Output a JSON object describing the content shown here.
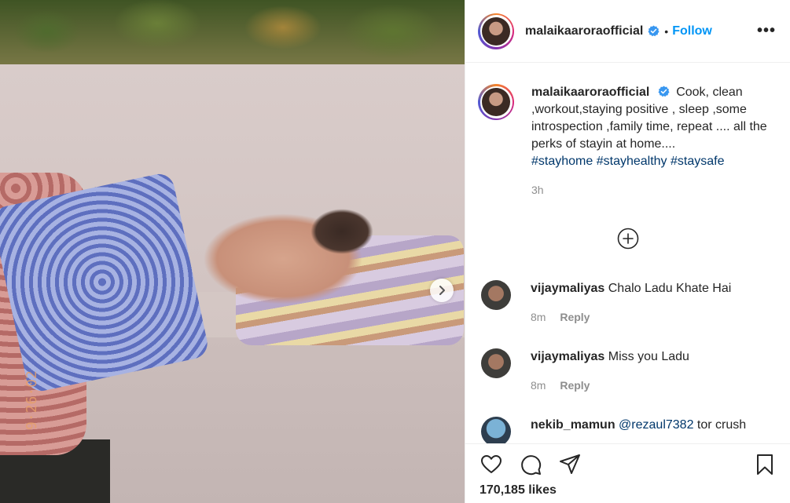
{
  "post": {
    "photo_stamp": "9·26·02",
    "next_label": "Next"
  },
  "header": {
    "username": "malaikaaroraofficial",
    "separator": "•",
    "follow_label": "Follow",
    "more_label": "•••"
  },
  "caption": {
    "username": "malaikaaroraofficial",
    "text": "Cook, clean ,workout,staying positive , sleep ,some introspection ,family time, repeat .... all the perks of stayin at home....",
    "hashtags": [
      "#stayhome",
      "#stayhealthy",
      "#staysafe"
    ],
    "time": "3h"
  },
  "comments": [
    {
      "username": "vijaymaliyas",
      "text": "Chalo Ladu Khate Hai",
      "time": "8m",
      "reply_label": "Reply"
    },
    {
      "username": "vijaymaliyas",
      "text": "Miss you Ladu",
      "time": "8m",
      "reply_label": "Reply"
    },
    {
      "username": "nekib_mamun",
      "mention": "@rezaul7382",
      "text": "tor crush"
    }
  ],
  "footer": {
    "likes": "170,185 likes"
  },
  "colors": {
    "link": "#0095f6",
    "hashtag": "#00376b",
    "muted": "#8e8e8e",
    "text": "#262626"
  },
  "icons": [
    "chevron-right-icon",
    "verified-badge-icon",
    "more-icon",
    "add-circle-icon",
    "heart-icon",
    "comment-icon",
    "share-icon",
    "bookmark-icon"
  ]
}
